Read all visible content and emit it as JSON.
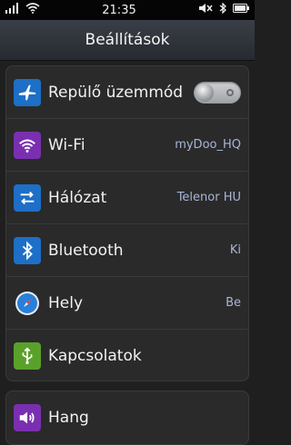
{
  "statusbar": {
    "time": "21:35"
  },
  "header": {
    "title": "Beállítások"
  },
  "settings": {
    "items": [
      {
        "label": "Repülő üzemmód",
        "value": "",
        "icon": "airplane-icon",
        "color": "#1d6fc7"
      },
      {
        "label": "Wi-Fi",
        "value": "myDoo_HQ",
        "icon": "wifi-icon",
        "color": "#7a2fb0"
      },
      {
        "label": "Hálózat",
        "value": "Telenor HU",
        "icon": "network-icon",
        "color": "#1d6fc7"
      },
      {
        "label": "Bluetooth",
        "value": "Ki",
        "icon": "bluetooth-icon",
        "color": "#1d6fc7"
      },
      {
        "label": "Hely",
        "value": "Be",
        "icon": "location-icon",
        "color": "#1d6fc7"
      },
      {
        "label": "Kapcsolatok",
        "value": "",
        "icon": "usb-icon",
        "color": "#5aa12a"
      }
    ],
    "second": [
      {
        "label": "Hang",
        "value": "",
        "icon": "speaker-icon",
        "color": "#7a2fb0"
      }
    ]
  }
}
